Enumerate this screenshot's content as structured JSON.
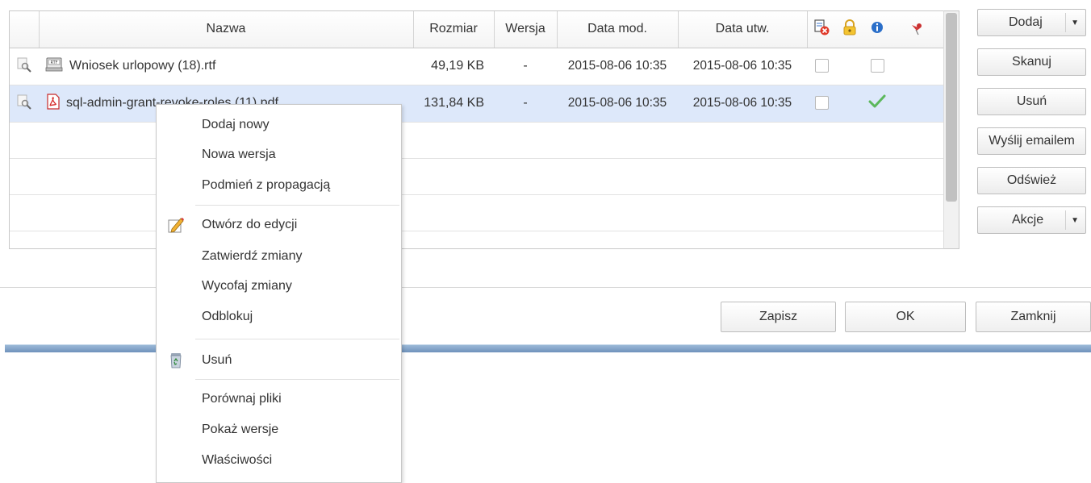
{
  "grid": {
    "columns": {
      "name": "Nazwa",
      "size": "Rozmiar",
      "version": "Wersja",
      "modified": "Data mod.",
      "created": "Data utw."
    },
    "header_icons": [
      "document-delete-icon",
      "padlock-icon",
      "info-icon",
      "pin-icon"
    ],
    "rows": [
      {
        "file_icon": "rtf-file-icon",
        "name": "Wniosek urlopowy (18).rtf",
        "size": "49,19 KB",
        "version": "-",
        "modified": "2015-08-06 10:35",
        "created": "2015-08-06 10:35",
        "locked": false,
        "info_checked": false,
        "selected": false
      },
      {
        "file_icon": "pdf-file-icon",
        "name": "sql-admin-grant-revoke-roles (11).pdf",
        "size": "131,84 KB",
        "version": "-",
        "modified": "2015-08-06 10:35",
        "created": "2015-08-06 10:35",
        "locked": false,
        "info_checked": true,
        "selected": true
      }
    ]
  },
  "side_buttons": {
    "add": "Dodaj",
    "scan": "Skanuj",
    "delete": "Usuń",
    "email": "Wyślij emailem",
    "refresh": "Odśwież",
    "actions": "Akcje"
  },
  "footer": {
    "save": "Zapisz",
    "ok": "OK",
    "close": "Zamknij"
  },
  "context_menu": {
    "add_new": "Dodaj nowy",
    "new_version": "Nowa wersja",
    "replace_propagate": "Podmień z propagacją",
    "open_edit": "Otwórz do edycji",
    "commit": "Zatwierdź zmiany",
    "revert": "Wycofaj zmiany",
    "unlock": "Odblokuj",
    "delete": "Usuń",
    "compare": "Porównaj pliki",
    "versions": "Pokaż wersje",
    "properties": "Właściwości"
  },
  "colors": {
    "selected_row": "#dde8fa",
    "accent_bar": "#6f92bb",
    "check_green": "#5cb85c",
    "pdf_red": "#d62a2a"
  }
}
